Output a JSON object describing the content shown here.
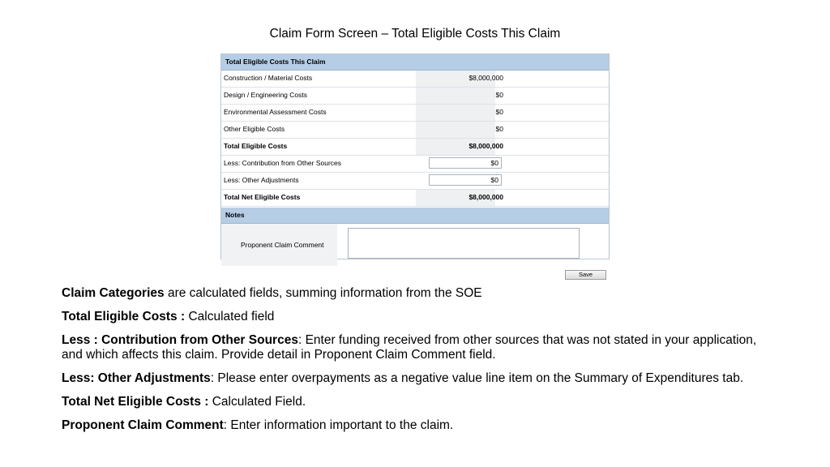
{
  "slide": {
    "title": "Claim Form Screen – Total Eligible Costs This Claim"
  },
  "form": {
    "cost_section_title": "Total Eligible Costs This Claim",
    "rows": [
      {
        "label": "Construction / Material Costs",
        "value": "$8,000,000"
      },
      {
        "label": "Design / Engineering Costs",
        "value": "$0"
      },
      {
        "label": "Environmental Assessment Costs",
        "value": "$0"
      },
      {
        "label": "Other Eligible Costs",
        "value": "$0"
      },
      {
        "label": "Total Eligible Costs",
        "value": "$8,000,000"
      },
      {
        "label": "Less: Contribution from Other Sources",
        "value": "$0"
      },
      {
        "label": "Less: Other Adjustments",
        "value": "$0"
      },
      {
        "label": "Total Net Eligible Costs",
        "value": "$8,000,000"
      }
    ],
    "notes_section_title": "Notes",
    "comment_label": "Proponent Claim Comment",
    "save_label": "Save"
  },
  "descriptions": [
    {
      "term": "Claim Categories",
      "text": " are calculated fields, summing information from the SOE"
    },
    {
      "term": "Total Eligible Costs :",
      "text": "  Calculated field"
    },
    {
      "term": "Less : Contribution from Other Sources",
      "text": ":  Enter funding received from other sources that was not stated in your application, and which affects this claim. Provide detail in Proponent Claim Comment field."
    },
    {
      "term": "Less: Other Adjustments",
      "text": ":  Please enter overpayments as a negative value line item on the Summary of Expenditures tab."
    },
    {
      "term": "Total Net Eligible Costs :",
      "text": " Calculated Field."
    },
    {
      "term": "Proponent Claim Comment",
      "text": ": Enter information important to the claim."
    }
  ]
}
